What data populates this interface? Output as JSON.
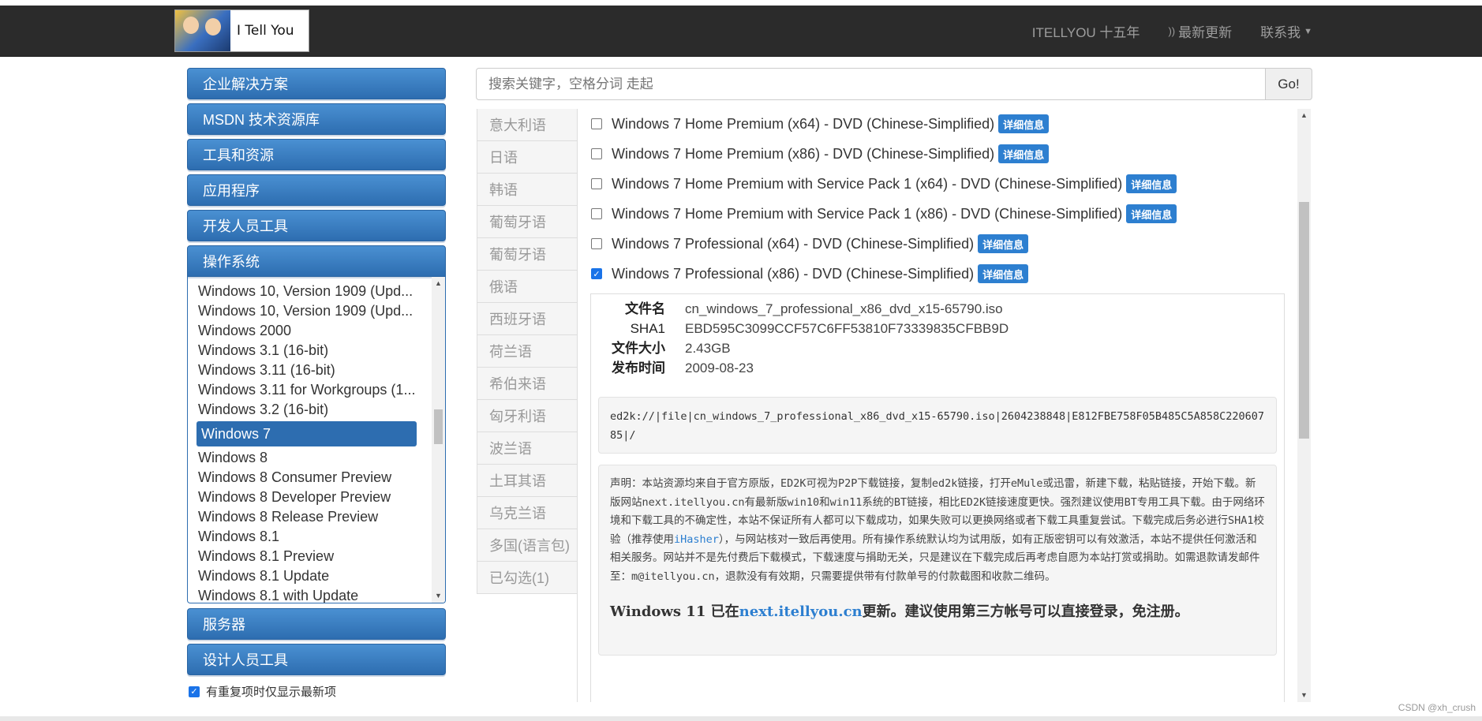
{
  "header": {
    "logo_text": "I Tell You",
    "nav": [
      {
        "label": "ITELLYOU 十五年"
      },
      {
        "label": "最新更新",
        "icon": "rss-icon"
      },
      {
        "label": "联系我",
        "icon": "caret-down-icon"
      }
    ]
  },
  "sidebar": {
    "categories_top": [
      "企业解决方案",
      "MSDN 技术资源库",
      "工具和资源",
      "应用程序",
      "开发人员工具"
    ],
    "active_category": "操作系统",
    "os_items": [
      "Windows 10, Version 1909 (Upd...",
      "Windows 10, Version 1909 (Upd...",
      "Windows 2000",
      "Windows 3.1 (16-bit)",
      "Windows 3.11 (16-bit)",
      "Windows 3.11 for Workgroups (1...",
      "Windows 3.2 (16-bit)",
      "Windows 7",
      "Windows 8",
      "Windows 8 Consumer Preview",
      "Windows 8 Developer Preview",
      "Windows 8 Release Preview",
      "Windows 8.1",
      "Windows 8.1 Preview",
      "Windows 8.1 Update",
      "Windows 8.1 with Update"
    ],
    "selected_os": "Windows 7",
    "categories_bottom": [
      "服务器",
      "设计人员工具"
    ],
    "checkbox_label": "有重复项时仅显示最新项",
    "checkbox_checked": true
  },
  "search": {
    "placeholder": "搜索关键字，空格分词 走起",
    "button": "Go!"
  },
  "languages": [
    "意大利语",
    "日语",
    "韩语",
    "葡萄牙语",
    "葡萄牙语",
    "俄语",
    "西班牙语",
    "荷兰语",
    "希伯来语",
    "匈牙利语",
    "波兰语",
    "土耳其语",
    "乌克兰语",
    "多国(语言包)",
    "已勾选(1)"
  ],
  "releases": [
    {
      "name": "Windows 7 Home Premium (x64) - DVD (Chinese-Simplified)",
      "checked": false
    },
    {
      "name": "Windows 7 Home Premium (x86) - DVD (Chinese-Simplified)",
      "checked": false
    },
    {
      "name": "Windows 7 Home Premium with Service Pack 1 (x64) - DVD (Chinese-Simplified)",
      "checked": false
    },
    {
      "name": "Windows 7 Home Premium with Service Pack 1 (x86) - DVD (Chinese-Simplified)",
      "checked": false
    },
    {
      "name": "Windows 7 Professional (x64) - DVD (Chinese-Simplified)",
      "checked": false
    },
    {
      "name": "Windows 7 Professional (x86) - DVD (Chinese-Simplified)",
      "checked": true
    }
  ],
  "detail_badge": "详细信息",
  "detail": {
    "filename_label": "文件名",
    "filename": "cn_windows_7_professional_x86_dvd_x15-65790.iso",
    "sha1_label": "SHA1",
    "sha1": "EBD595C3099CCF57C6FF53810F73339835CFBB9D",
    "size_label": "文件大小",
    "size": "2.43GB",
    "date_label": "发布时间",
    "date": "2009-08-23",
    "ed2k": "ed2k://|file|cn_windows_7_professional_x86_dvd_x15-65790.iso|2604238848|E812FBE758F05B485C5A858C22060785|/"
  },
  "notice": {
    "text_before": "声明：本站资源均来自于官方原版，ED2K可视为P2P下载链接，复制ed2k链接，打开eMule或迅雷，新建下载，粘贴链接，开始下载。新版网站next.itellyou.cn有最新版win10和win11系统的BT链接，相比ED2K链接速度更快。强烈建议使用BT专用工具下载。由于网络环境和下载工具的不确定性，本站不保证所有人都可以下载成功，如果失败可以更换网络或者下载工具重复尝试。下载完成后务必进行SHA1校验（推荐使用",
    "tool": "iHasher",
    "text_after": "），与网站核对一致后再使用。所有操作系统默认均为试用版，如有正版密钥可以有效激活，本站不提供任何激活和相关服务。网站并不是先付费后下载模式，下载速度与捐助无关，只是建议在下载完成后再考虑自愿为本站打赏或捐助。如需退款请发邮件至：m@itellyou.cn，退款没有有效期，只需要提供带有付款单号的付款截图和收款二维码。",
    "big_before": "Windows 11 已在",
    "big_link": "next.itellyou.cn",
    "big_after": "更新。建议使用第三方帐号可以直接登录，免注册。"
  },
  "watermark": "CSDN @xh_crush"
}
